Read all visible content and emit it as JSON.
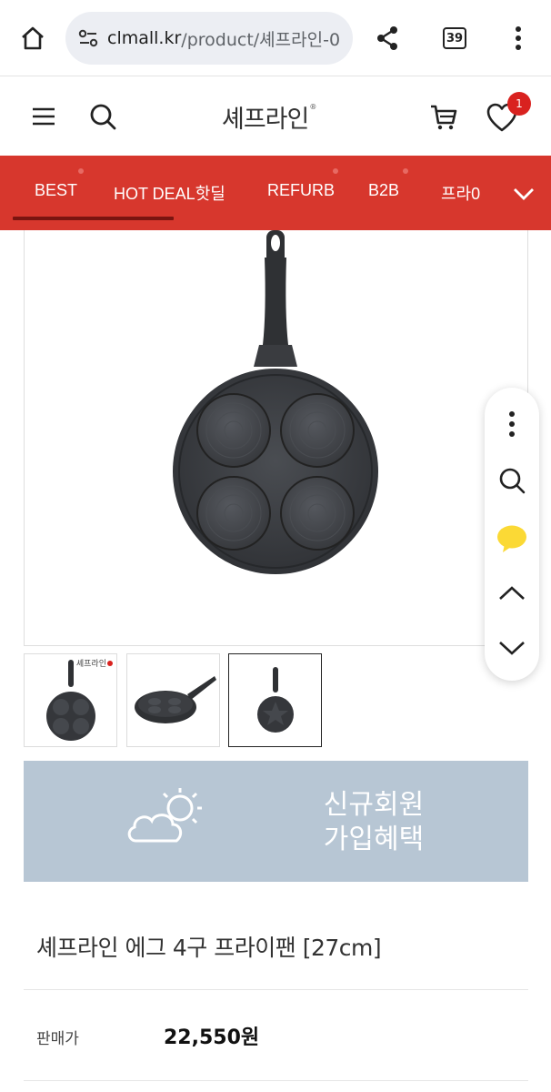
{
  "browser": {
    "url_host": "clmall.kr",
    "url_path": "/product/셰프라인-0",
    "tab_count": "39",
    "icons": [
      "home-icon",
      "site-settings-icon",
      "share-icon",
      "tabs-icon",
      "more-vert-icon"
    ]
  },
  "header": {
    "logo_text": "셰프라인",
    "logo_mark": "®",
    "wishlist_badge": "1",
    "icons": [
      "menu-icon",
      "search-icon",
      "cart-icon",
      "heart-icon"
    ]
  },
  "category_nav": {
    "items": [
      {
        "label": "BEST",
        "active": true
      },
      {
        "label": "HOT DEAL핫딜"
      },
      {
        "label": "REFURB"
      },
      {
        "label": "B2B"
      },
      {
        "label": "프라0"
      }
    ],
    "accent_color": "#d7372d"
  },
  "product": {
    "title": "셰프라인 에그 4구 프라이팬 [27cm]",
    "price_label": "판매가",
    "price": "22,550원",
    "thumbnail_logo": "셰프라인"
  },
  "promo_banner": {
    "line1": "신규회원",
    "line2": "가입혜택",
    "color": "#b7c6d4"
  },
  "side_toolbar": {
    "icons": [
      "more-vert-icon",
      "search-icon",
      "chat-bubble-icon",
      "chevron-up-icon",
      "chevron-down-icon"
    ]
  }
}
